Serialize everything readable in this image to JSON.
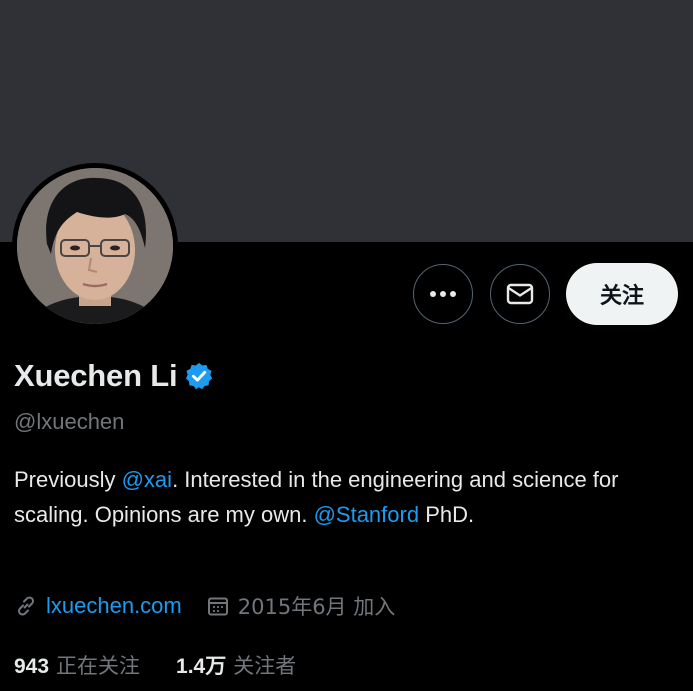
{
  "profile": {
    "name": "Xuechen Li",
    "handle": "@lxuechen",
    "verified": true,
    "bio": {
      "part1": "Previously ",
      "mention1": "@xai",
      "part2": ". Interested in the engineering and science for scaling. Opinions are my own. ",
      "mention2": "@Stanford",
      "part3": " PhD."
    },
    "website": "lxuechen.com",
    "joined": "2015年6月 加入",
    "following_count": "943",
    "following_label": "正在关注",
    "followers_count": "1.4万",
    "followers_label": "关注者"
  },
  "actions": {
    "more_icon": "more-horizontal-icon",
    "message_icon": "envelope-icon",
    "follow_label": "关注"
  },
  "colors": {
    "banner": "#2f3136",
    "accent": "#1d9bf0",
    "muted_text": "#71767b",
    "primary_text": "#e7e9ea"
  }
}
